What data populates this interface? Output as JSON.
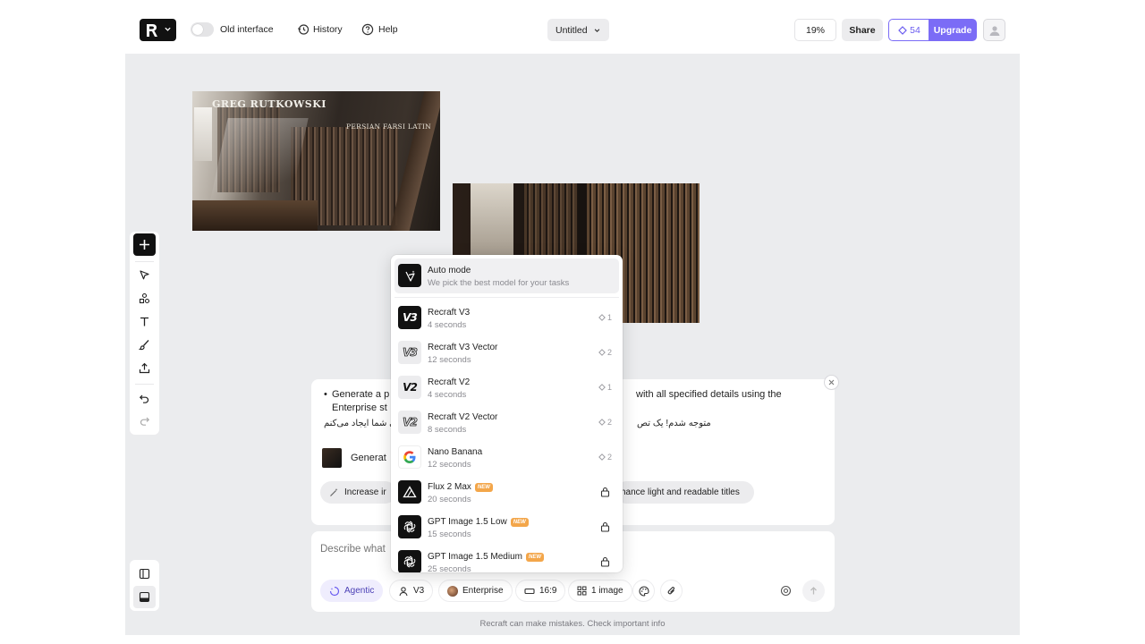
{
  "topbar": {
    "old_interface_label": "Old interface",
    "history_label": "History",
    "help_label": "Help",
    "title": "Untitled",
    "zoom": "19%",
    "share_label": "Share",
    "credits": "54",
    "upgrade_label": "Upgrade"
  },
  "canvas": {
    "image1_text_top": "GREG RUTKOWSKI",
    "image1_text_shelf": "PERSIAN FARSI LATIN"
  },
  "chat": {
    "bullet_left": "Generate a p",
    "bullet_right": "with all specified details using the",
    "bullet_line2": "Enterprise st",
    "farsi_left": "ی شما ایجاد می‌کنم",
    "farsi_right": "متوجه شدم! یک تص",
    "generate_label": "Generat",
    "chip_left": "Increase ir",
    "chip_right": "hance light and readable titles",
    "input_placeholder": "Describe what",
    "disclaimer": "Recraft can make mistakes. Check important info"
  },
  "prompt_bar": {
    "agentic": "Agentic",
    "model": "V3",
    "style": "Enterprise",
    "ratio": "16:9",
    "count": "1 image"
  },
  "models": {
    "auto": {
      "name": "Auto mode",
      "sub": "We pick the best model for your tasks"
    },
    "items": [
      {
        "name": "Recraft V3",
        "sub": "4 seconds",
        "cost": "1",
        "icon": "V3"
      },
      {
        "name": "Recraft V3 Vector",
        "sub": "12 seconds",
        "cost": "2",
        "icon": "V3"
      },
      {
        "name": "Recraft V2",
        "sub": "4 seconds",
        "cost": "1",
        "icon": "V2"
      },
      {
        "name": "Recraft V2 Vector",
        "sub": "8 seconds",
        "cost": "2",
        "icon": "V2"
      },
      {
        "name": "Nano Banana",
        "sub": "12 seconds",
        "cost": "2",
        "icon": "google-icon"
      },
      {
        "name": "Flux 2 Max",
        "sub": "20 seconds",
        "badge": "NEW",
        "icon": "flux-icon"
      },
      {
        "name": "GPT Image 1.5 Low",
        "sub": "15 seconds",
        "badge": "NEW",
        "icon": "openai-icon"
      },
      {
        "name": "GPT Image 1.5 Medium",
        "sub": "25 seconds",
        "badge": "NEW",
        "icon": "openai-icon"
      }
    ]
  },
  "colors": {
    "accent": "#7b6cf6",
    "badge": "#f3a64a"
  }
}
